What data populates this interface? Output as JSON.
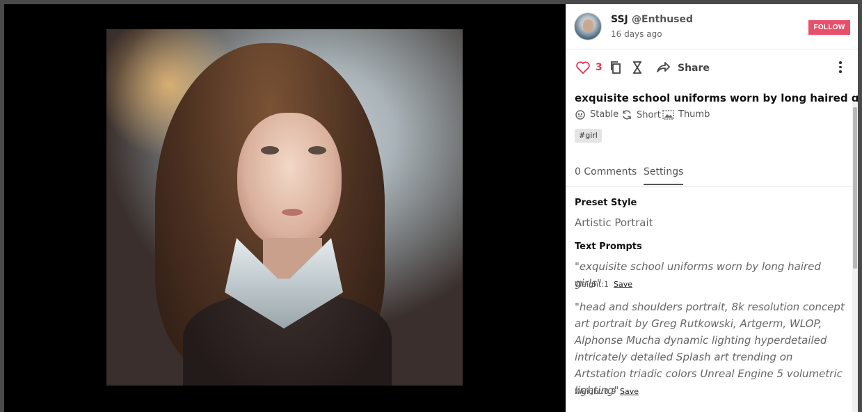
{
  "post": {
    "username": "SSJ",
    "handle": "@Enthused",
    "posted": "16 days ago",
    "follow_label": "FOLLOW"
  },
  "actions": {
    "like_count": "3",
    "share_label": "Share"
  },
  "details": {
    "title": "exquisite school uniforms worn by long haired girls",
    "meta": [
      {
        "icon": "stable-diffusion-icon",
        "label": "Stable"
      },
      {
        "icon": "refresh-icon",
        "label": "Short"
      },
      {
        "icon": "thumbnail-icon",
        "label": "Thumb"
      }
    ],
    "tag": "#girl"
  },
  "tabs": {
    "comments": "0 Comments",
    "settings": "Settings",
    "active": "settings"
  },
  "settings": {
    "preset_heading": "Preset Style",
    "preset_value": "Artistic Portrait",
    "prompts_heading": "Text Prompts",
    "prompt1": "\"exquisite school uniforms worn by long haired girls\"",
    "weight1": "Weight:1",
    "prompt2": "\"head and shoulders portrait, 8k resolution concept art portrait by Greg Rutkowski, Artgerm, WLOP, Alphonse Mucha dynamic lighting hyperdetailed intricately detailed Splash art trending on Artstation triadic colors Unreal Engine 5 volumetric lighting\"",
    "weight2": "Weight:0.9",
    "save_label": "Save"
  },
  "colors": {
    "accent": "#e8506a",
    "like": "#e03a55"
  }
}
